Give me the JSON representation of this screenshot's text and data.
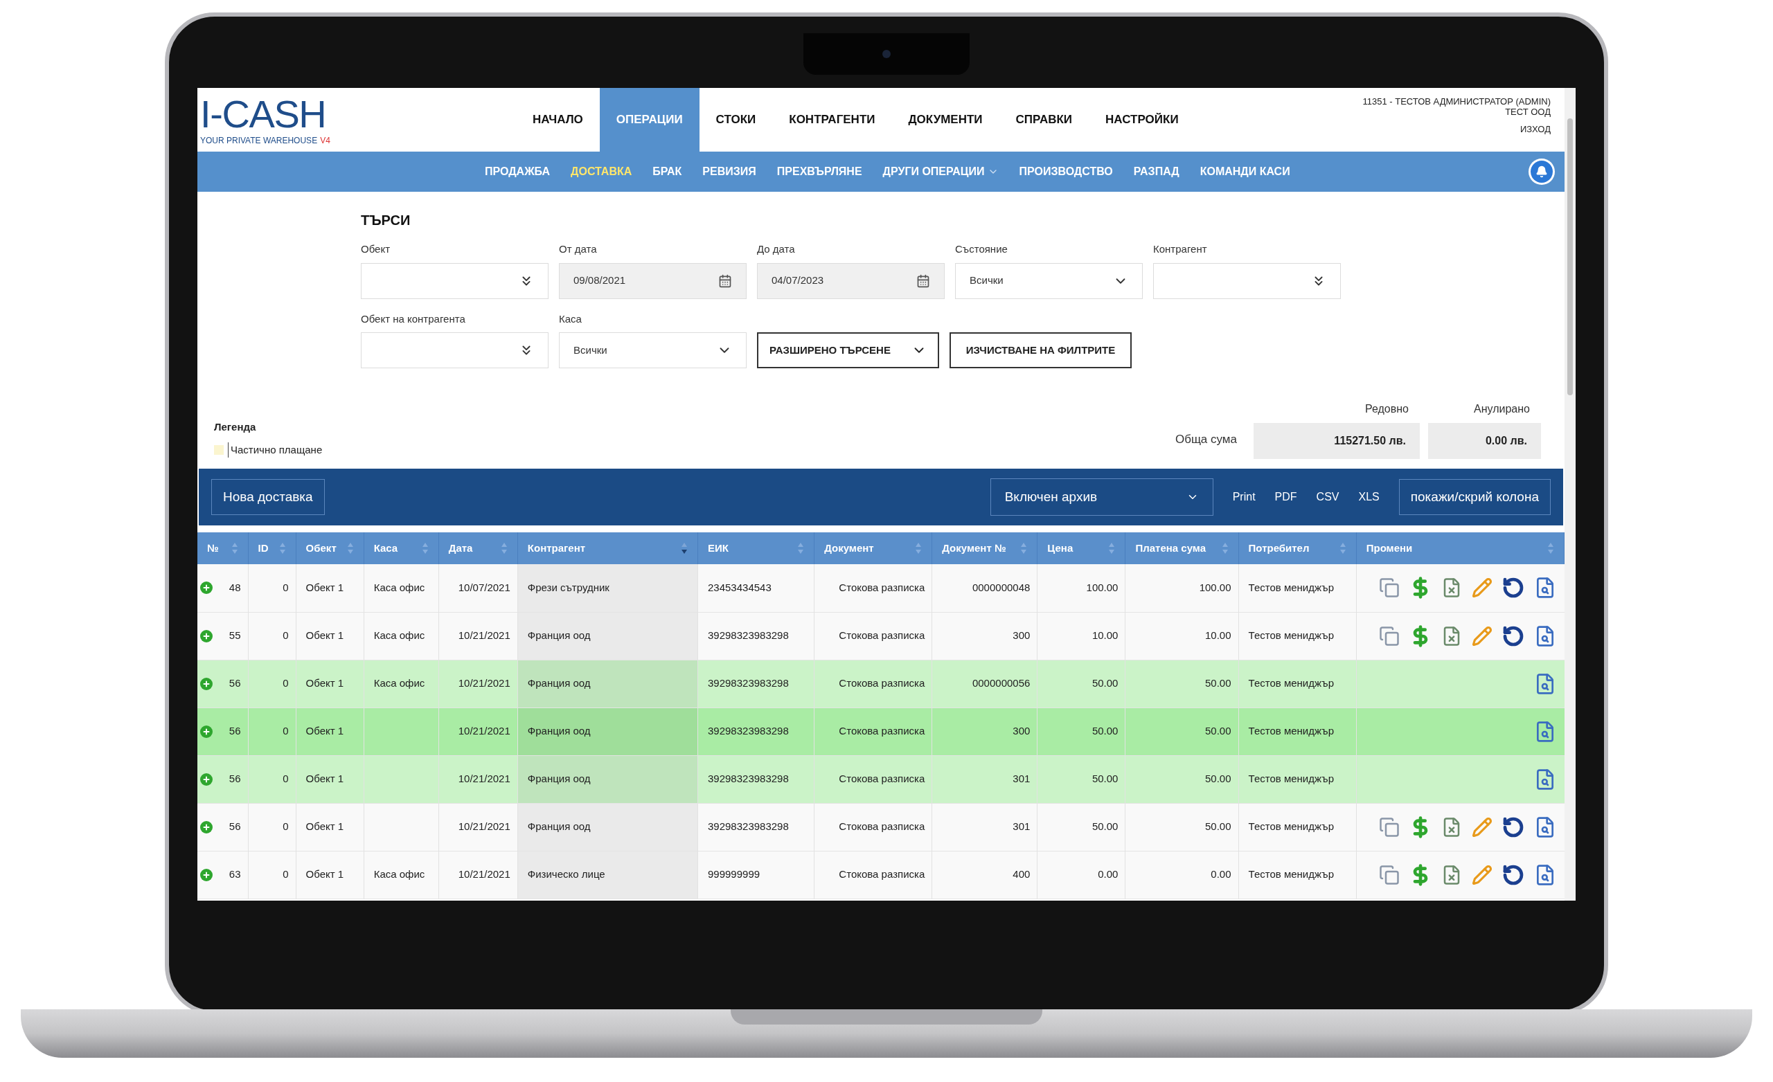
{
  "app": {
    "logo": "I-CASH",
    "tagline": "YOUR PRIVATE WAREHOUSE",
    "version": "V4"
  },
  "nav": [
    {
      "label": "НАЧАЛО",
      "selected": false
    },
    {
      "label": "ОПЕРАЦИИ",
      "selected": true
    },
    {
      "label": "СТОКИ",
      "selected": false
    },
    {
      "label": "КОНТРАГЕНТИ",
      "selected": false
    },
    {
      "label": "ДОКУМЕНТИ",
      "selected": false
    },
    {
      "label": "СПРАВКИ",
      "selected": false
    },
    {
      "label": "НАСТРОЙКИ",
      "selected": false
    }
  ],
  "user": {
    "name": "11351 - ТЕСТОВ АДМИНИСТРАТОР (ADMIN)",
    "company": "ТЕСТ ООД",
    "logout": "ИЗХОД"
  },
  "subnav": [
    {
      "label": "ПРОДАЖБА",
      "selected": false,
      "has_menu": false
    },
    {
      "label": "ДОСТАВКА",
      "selected": true,
      "has_menu": false
    },
    {
      "label": "БРАК",
      "selected": false,
      "has_menu": false
    },
    {
      "label": "РЕВИЗИЯ",
      "selected": false,
      "has_menu": false
    },
    {
      "label": "ПРЕХВЪРЛЯНЕ",
      "selected": false,
      "has_menu": false
    },
    {
      "label": "ДРУГИ ОПЕРАЦИИ",
      "selected": false,
      "has_menu": true
    },
    {
      "label": "ПРОИЗВОДСТВО",
      "selected": false,
      "has_menu": false
    },
    {
      "label": "РАЗПАД",
      "selected": false,
      "has_menu": false
    },
    {
      "label": "КОМАНДИ КАСИ",
      "selected": false,
      "has_menu": false
    }
  ],
  "search": {
    "title": "ТЪРСИ",
    "rows": [
      [
        {
          "kind": "picker",
          "label": "Обект"
        },
        {
          "kind": "date",
          "label": "От дата",
          "value": "09/08/2021"
        },
        {
          "kind": "date",
          "label": "До дата",
          "value": "04/07/2023"
        },
        {
          "kind": "select",
          "label": "Състояние",
          "value": "Всички"
        },
        {
          "kind": "picker",
          "label": "Контрагент"
        }
      ],
      [
        {
          "kind": "picker",
          "label": "Обект на контрагента"
        },
        {
          "kind": "select",
          "label": "Каса",
          "value": "Всички"
        },
        {
          "kind": "dropdown-button",
          "value": "РАЗШИРЕНО ТЪРСЕНЕ"
        },
        {
          "kind": "button",
          "value": "ИЗЧИСТВАНЕ НА ФИЛТРИТЕ"
        }
      ]
    ]
  },
  "legend": {
    "title": "Легенда",
    "items": [
      {
        "label": "Частично плащане",
        "color": "#fbf5cf"
      }
    ]
  },
  "totals": {
    "label": "Обща сума",
    "columns": [
      {
        "heading": "Редовно",
        "value": "115271.50 лв."
      },
      {
        "heading": "Анулирано",
        "value": "0.00 лв."
      }
    ]
  },
  "toolbar": {
    "new_button": "Нова доставка",
    "archive_select": "Включен архив",
    "exports": [
      "Print",
      "PDF",
      "CSV",
      "XLS"
    ],
    "columns_button": "покажи/скрий колона"
  },
  "table": {
    "columns": [
      {
        "label": "№",
        "sorted": false
      },
      {
        "label": "ID",
        "sorted": false
      },
      {
        "label": "Обект",
        "sorted": false
      },
      {
        "label": "Каса",
        "sorted": false
      },
      {
        "label": "Дата",
        "sorted": false
      },
      {
        "label": "Контрагент",
        "sorted": true
      },
      {
        "label": "ЕИК",
        "sorted": false
      },
      {
        "label": "Документ",
        "sorted": false
      },
      {
        "label": "Документ №",
        "sorted": false
      },
      {
        "label": "Цена",
        "sorted": false
      },
      {
        "label": "Платена сума",
        "sorted": false
      },
      {
        "label": "Потребител",
        "sorted": false
      },
      {
        "label": "Промени",
        "sorted": false
      }
    ],
    "rows": [
      {
        "color": "#f9f9f9",
        "editable": true,
        "cells": [
          "48",
          "0",
          "Обект 1",
          "Каса офис",
          "10/07/2021",
          "Фрези сътрудник",
          "23453434543",
          "Стокова разписка",
          "0000000048",
          "100.00",
          "100.00",
          "Тестов мениджър"
        ]
      },
      {
        "color": "#f9f9f9",
        "editable": true,
        "cells": [
          "55",
          "0",
          "Обект 1",
          "Каса офис",
          "10/21/2021",
          "Франция оод",
          "39298323983298",
          "Стокова разписка",
          "300",
          "10.00",
          "10.00",
          "Тестов мениджър"
        ]
      },
      {
        "color": "#cbf3c8",
        "editable": false,
        "cells": [
          "56",
          "0",
          "Обект 1",
          "Каса офис",
          "10/21/2021",
          "Франция оод",
          "39298323983298",
          "Стокова разписка",
          "0000000056",
          "50.00",
          "50.00",
          "Тестов мениджър"
        ]
      },
      {
        "color": "#a9eca4",
        "editable": false,
        "cells": [
          "56",
          "0",
          "Обект 1",
          "",
          "10/21/2021",
          "Франция оод",
          "39298323983298",
          "Стокова разписка",
          "300",
          "50.00",
          "50.00",
          "Тестов мениджър"
        ]
      },
      {
        "color": "#cbf3c8",
        "editable": false,
        "cells": [
          "56",
          "0",
          "Обект 1",
          "",
          "10/21/2021",
          "Франция оод",
          "39298323983298",
          "Стокова разписка",
          "301",
          "50.00",
          "50.00",
          "Тестов мениджър"
        ]
      },
      {
        "color": "#f9f9f9",
        "editable": true,
        "cells": [
          "56",
          "0",
          "Обект 1",
          "",
          "10/21/2021",
          "Франция оод",
          "39298323983298",
          "Стокова разписка",
          "301",
          "50.00",
          "50.00",
          "Тестов мениджър"
        ]
      },
      {
        "color": "#f9f9f9",
        "editable": true,
        "cells": [
          "63",
          "0",
          "Обект 1",
          "Каса офис",
          "10/21/2021",
          "Физическо лице",
          "999999999",
          "Стокова разписка",
          "400",
          "0.00",
          "0.00",
          "Тестов мениджър"
        ]
      }
    ]
  }
}
